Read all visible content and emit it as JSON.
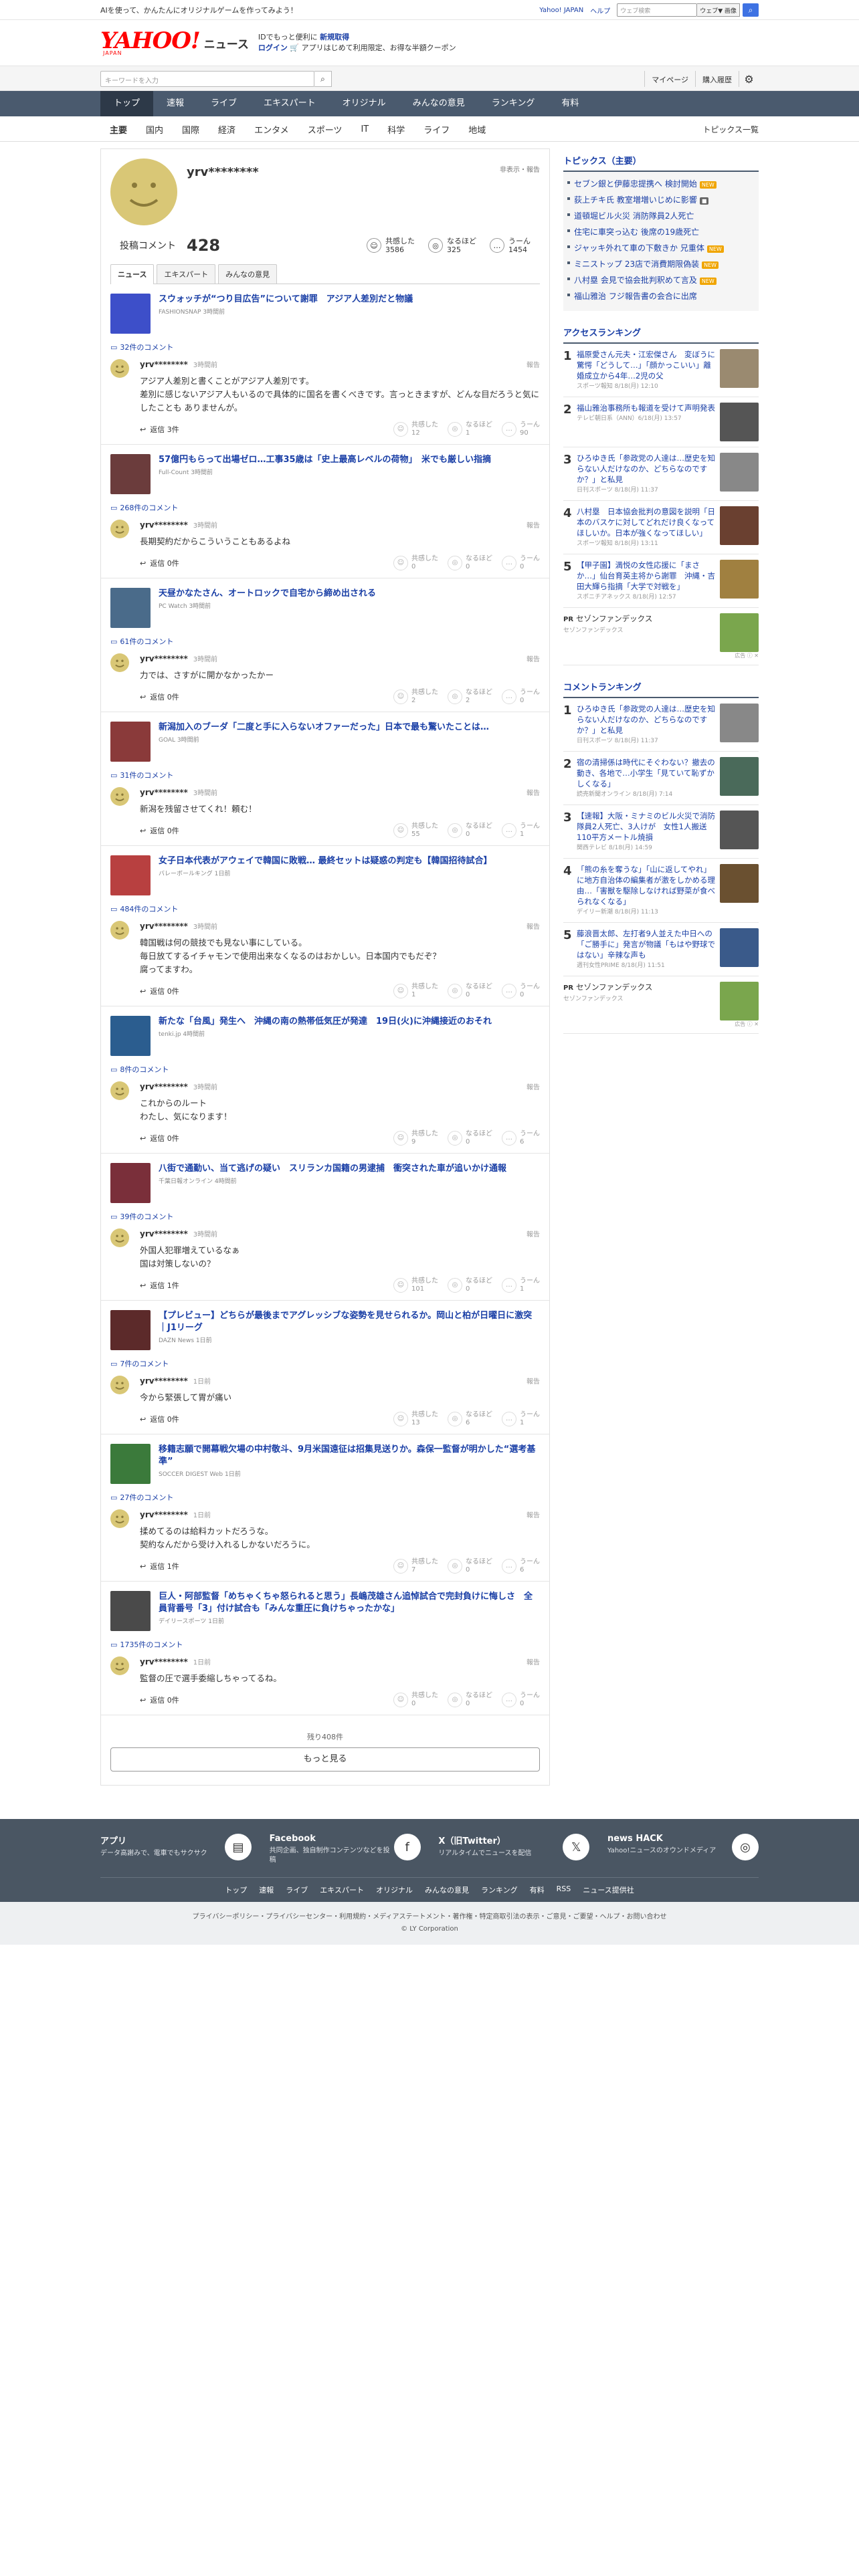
{
  "promo": {
    "text": "AIを使って、かんたんにオリジナルゲームを作ってみよう！",
    "yj_link": "Yahoo! JAPAN",
    "help": "ヘルプ",
    "search_placeholder": "ウェブ検索",
    "web_label": "ウェブ▼ 画像",
    "search_btn": "検索"
  },
  "header": {
    "logo": "YAHOO!",
    "logo_sub": "JAPAN",
    "news": "ニュース",
    "msg1": "IDでもっと便利に",
    "msg1_link": "新規取得",
    "msg2_link": "ログイン",
    "msg2": "🛒 アプリはじめて利用限定、お得な半額クーポン"
  },
  "searchbar": {
    "placeholder": "キーワードを入力",
    "mypage": "マイページ",
    "history": "購入履歴"
  },
  "nav": [
    "トップ",
    "速報",
    "ライブ",
    "エキスパート",
    "オリジナル",
    "みんなの意見",
    "ランキング",
    "有料"
  ],
  "subnav": [
    "主要",
    "国内",
    "国際",
    "経済",
    "エンタメ",
    "スポーツ",
    "IT",
    "科学",
    "ライフ",
    "地域"
  ],
  "subnav_right": "トピックス一覧",
  "profile": {
    "name": "yrv********",
    "link": "非表示・報告",
    "count_label": "投稿コメント",
    "count": "428",
    "reactions": [
      {
        "icon": "☺",
        "label": "共感した",
        "value": "3586"
      },
      {
        "icon": "◎",
        "label": "なるほど",
        "value": "325"
      },
      {
        "icon": "…",
        "label": "うーん",
        "value": "1454"
      }
    ],
    "tabs": [
      "ニュース",
      "エキスパート",
      "みんなの意見"
    ]
  },
  "items": [
    {
      "title": "スウォッチが“つり目広告”について謝罪　アジア人差別だと物議",
      "source": "FASHIONSNAP 3時間前",
      "comments": "32件のコメント",
      "user": "yrv********",
      "time": "3時間前",
      "report": "報告",
      "text": "アジア人差別と書くことがアジア人差別です。\n差別に感じないアジア人もいるので具体的に国名を書くべきです。言っときますが、どんな目だろうと気にしたことも ありませんが。",
      "reply": "返信 3件",
      "v1": "12",
      "v2": "1",
      "v3": "90",
      "thumb": "#3d4fc9"
    },
    {
      "title": "57億円もらって出場ゼロ…工事35歳は「史上最高レベルの荷物」　米でも厳しい指摘",
      "source": "Full-Count 3時間前",
      "comments": "268件のコメント",
      "user": "yrv********",
      "time": "3時間前",
      "report": "報告",
      "text": "長期契約だからこういうこともあるよね",
      "reply": "返信 0件",
      "v1": "0",
      "v2": "0",
      "v3": "0",
      "thumb": "#6b3c3c"
    },
    {
      "title": "天昼かなたさん、オートロックで自宅から締め出される",
      "source": "PC Watch 3時間前",
      "comments": "61件のコメント",
      "user": "yrv********",
      "time": "3時間前",
      "report": "報告",
      "text": "力では、さすがに開かなかったかー",
      "reply": "返信 0件",
      "v1": "2",
      "v2": "2",
      "v3": "0",
      "thumb": "#4a6b8a"
    },
    {
      "title": "新潟加入のブーダ「二度と手に入らないオファーだった」日本で最も驚いたことは…",
      "source": "GOAL 3時間前",
      "comments": "31件のコメント",
      "user": "yrv********",
      "time": "3時間前",
      "report": "報告",
      "text": "新潟を残留させてくれ！頼む！",
      "reply": "返信 0件",
      "v1": "55",
      "v2": "0",
      "v3": "1",
      "thumb": "#8a3a3a"
    },
    {
      "title": "女子日本代表がアウェイで韓国に敗戦… 最終セットは疑惑の判定も【韓国招待試合】",
      "source": "バレーボールキング 1日前",
      "comments": "484件のコメント",
      "user": "yrv********",
      "time": "3時間前",
      "report": "報告",
      "text": "韓国戦は何の競技でも見ない事にしている。\n毎日放てするイチャモンで使用出来なくなるのはおかしい。日本国内でもだぞ？\n腐ってますわ。",
      "reply": "返信 0件",
      "v1": "1",
      "v2": "0",
      "v3": "0",
      "thumb": "#b84040"
    },
    {
      "title": "新たな「台風」発生へ　沖縄の南の熱帯低気圧が発達　19日(火)に沖縄接近のおそれ",
      "source": "tenki.jp 4時間前",
      "comments": "8件のコメント",
      "user": "yrv********",
      "time": "3時間前",
      "report": "報告",
      "text": "これからのルート\nわたし、気になります！",
      "reply": "返信 0件",
      "v1": "9",
      "v2": "0",
      "v3": "6",
      "thumb": "#2b5d8f"
    },
    {
      "title": "八街で通勤い、当て逃げの疑い　スリランカ国籍の男逮捕　衝突された車が追いかけ通報",
      "source": "千葉日報オンライン 4時間前",
      "comments": "39件のコメント",
      "user": "yrv********",
      "time": "3時間前",
      "report": "報告",
      "text": "外国人犯罪増えているなぁ\n国は対策しないの？",
      "reply": "返信 1件",
      "v1": "101",
      "v2": "0",
      "v3": "1",
      "thumb": "#7a2f3a"
    },
    {
      "title": "【プレビュー】どちらが最後までアグレッシブな姿勢を見せられるか。岡山と柏が日曜日に激突｜J1リーグ",
      "source": "DAZN News 1日前",
      "comments": "7件のコメント",
      "user": "yrv********",
      "time": "1日前",
      "report": "報告",
      "text": "今から緊張して胃が痛い",
      "reply": "返信 0件",
      "v1": "13",
      "v2": "6",
      "v3": "1",
      "thumb": "#5c2a2a"
    },
    {
      "title": "移籍志願で開幕戦欠場の中村敬斗、9月米国遠征は招集見送りか。森保一監督が明かした“選考基準”",
      "source": "SOCCER DIGEST Web 1日前",
      "comments": "27件のコメント",
      "user": "yrv********",
      "time": "1日前",
      "report": "報告",
      "text": "揉めてるのは給料カットだろうな。\n契約なんだから受け入れるしかないだろうに。",
      "reply": "返信 1件",
      "v1": "7",
      "v2": "0",
      "v3": "6",
      "thumb": "#3b7a3b"
    },
    {
      "title": "巨人・阿部監督「めちゃくちゃ怒られると思う」長嶋茂雄さん追悼試合で完封負けに悔しさ　全員背番号「3」付け試合も「みんな重圧に負けちゃったかな」",
      "source": "デイリースポーツ 1日前",
      "comments": "1735件のコメント",
      "user": "yrv********",
      "time": "1日前",
      "report": "報告",
      "text": "監督の圧で選手委縮しちゃってるね。",
      "reply": "返信 0件",
      "v1": "0",
      "v2": "0",
      "v3": "0",
      "thumb": "#4a4a4a"
    }
  ],
  "more": {
    "rest": "残り408件",
    "btn": "もっと見る"
  },
  "right": {
    "topics_title": "トピックス（主要）",
    "topics": [
      {
        "t": "セブン銀と伊藤忠提携へ 検討開始",
        "tag": "NEW"
      },
      {
        "t": "荻上チキ氏 教室増増いじめに影響",
        "tag": "■"
      },
      {
        "t": "道頓堀ビル火災 消防隊員2人死亡",
        "tag": ""
      },
      {
        "t": "住宅に車突っ込む 後席の19歳死亡",
        "tag": ""
      },
      {
        "t": "ジャッキ外れて車の下敷きか 兄重体",
        "tag": "NEW"
      },
      {
        "t": "ミニストップ 23店で消費期限偽装",
        "tag": "NEW"
      },
      {
        "t": "八村塁 会見で協会批判釈めて言及",
        "tag": "NEW"
      },
      {
        "t": "福山雅治 フジ報告書の会合に出席",
        "tag": ""
      }
    ],
    "access_title": "アクセスランキング",
    "access": [
      {
        "n": "1",
        "t": "福原愛さん元夫・江宏傑さん　変ぼうに驚愕「どうして…」「顔かっこいい」離婚成立から4年…2児の父",
        "s": "スポーツ報知 8/18(月) 12:10",
        "c": "#9a8a70"
      },
      {
        "n": "2",
        "t": "福山雅治事務所も報道を受けて声明発表",
        "s": "テレビ朝日系（ANN）6/18(月) 13:57",
        "c": "#555"
      },
      {
        "n": "3",
        "t": "ひろゆき氏「参政党の人達は…歴史を知らない人だけなのか、どちらなのですか？」と私見",
        "s": "日刊スポーツ 8/18(月) 11:37",
        "c": "#888"
      },
      {
        "n": "4",
        "t": "八村塁　日本協会批判の意図を説明「日本のバスケに対してどれだけ良くなってほしいか。日本が強くなってほしい」",
        "s": "スポーツ報知 8/18(月) 13:11",
        "c": "#6a4030"
      },
      {
        "n": "5",
        "t": "【甲子園】満悦の女性応援に「まさか…」仙台育英主将から謝罪　沖縄・吉田大輝ら指摘「大学で対戦を」",
        "s": "スポニチアネックス 8/18(月) 12:57",
        "c": "#a08040"
      }
    ],
    "pr1": {
      "label": "PR",
      "t": "セゾンファンデックス",
      "s": "セゾンファンデックス",
      "ad": "広告 ⓘ ✕"
    },
    "comment_title": "コメントランキング",
    "comment": [
      {
        "n": "1",
        "t": "ひろゆき氏「参政党の人達は…歴史を知らない人だけなのか、どちらなのですか？」と私見",
        "s": "日刊スポーツ 8/18(月) 11:37",
        "c": "#888"
      },
      {
        "n": "2",
        "t": "宿の清掃係は時代にそぐわない？撤去の動き、各地で…小学生「見ていて恥ずかしくなる」",
        "s": "読売新聞オンライン 8/18(月) 7:14",
        "c": "#4a6a5a"
      },
      {
        "n": "3",
        "t": "【速報】大阪・ミナミのビル火災で消防隊員2人死亡、3人けが　女性1人搬送　110平方メートル焼損",
        "s": "関西テレビ 8/18(月) 14:59",
        "c": "#555"
      },
      {
        "n": "4",
        "t": "「熊の糸を奪うな」「山に返してやれ」に地方自治体の編集者が激をしかめる理由…「害獣を駆除しなければ野菜が食べられなくなる」",
        "s": "デイリー新潮 8/18(月) 11:13",
        "c": "#6a5030"
      },
      {
        "n": "5",
        "t": "藤浪晋太郎、左打者9人並えた中日への「ご勝手に」発言が物議「もはや野球ではない」辛辣な声も",
        "s": "週刊女性PRIME 8/18(月) 11:51",
        "c": "#3a5a8a"
      }
    ],
    "pr2": {
      "label": "PR",
      "t": "セゾンファンデックス",
      "s": "セゾンファンデックス",
      "ad": "広告 ⓘ ✕"
    }
  },
  "footer": {
    "apps": [
      {
        "n": "アプリ",
        "d": "データ高謝みで、電車でもサクサク",
        "ic": "▤"
      },
      {
        "n": "Facebook",
        "d": "共同企画、独自制作コンテンツなどを投稿",
        "ic": "f"
      },
      {
        "n": "X（旧Twitter）",
        "d": "リアルタイムでニュースを配信",
        "ic": "𝕏"
      },
      {
        "n": "news HACK",
        "d": "Yahoo!ニュースのオウンドメディア",
        "ic": "◎"
      }
    ],
    "links": [
      "トップ",
      "速報",
      "ライブ",
      "エキスパート",
      "オリジナル",
      "みんなの意見",
      "ランキング",
      "有料",
      "RSS",
      "ニュース提供社"
    ],
    "bottom": "プライバシーポリシー・プライバシーセンター・利用規約・メディアステートメント・著作権・特定商取引法の表示・ご意見・ご要望・ヘルプ・お問い合わせ",
    "copy": "© LY Corporation"
  }
}
